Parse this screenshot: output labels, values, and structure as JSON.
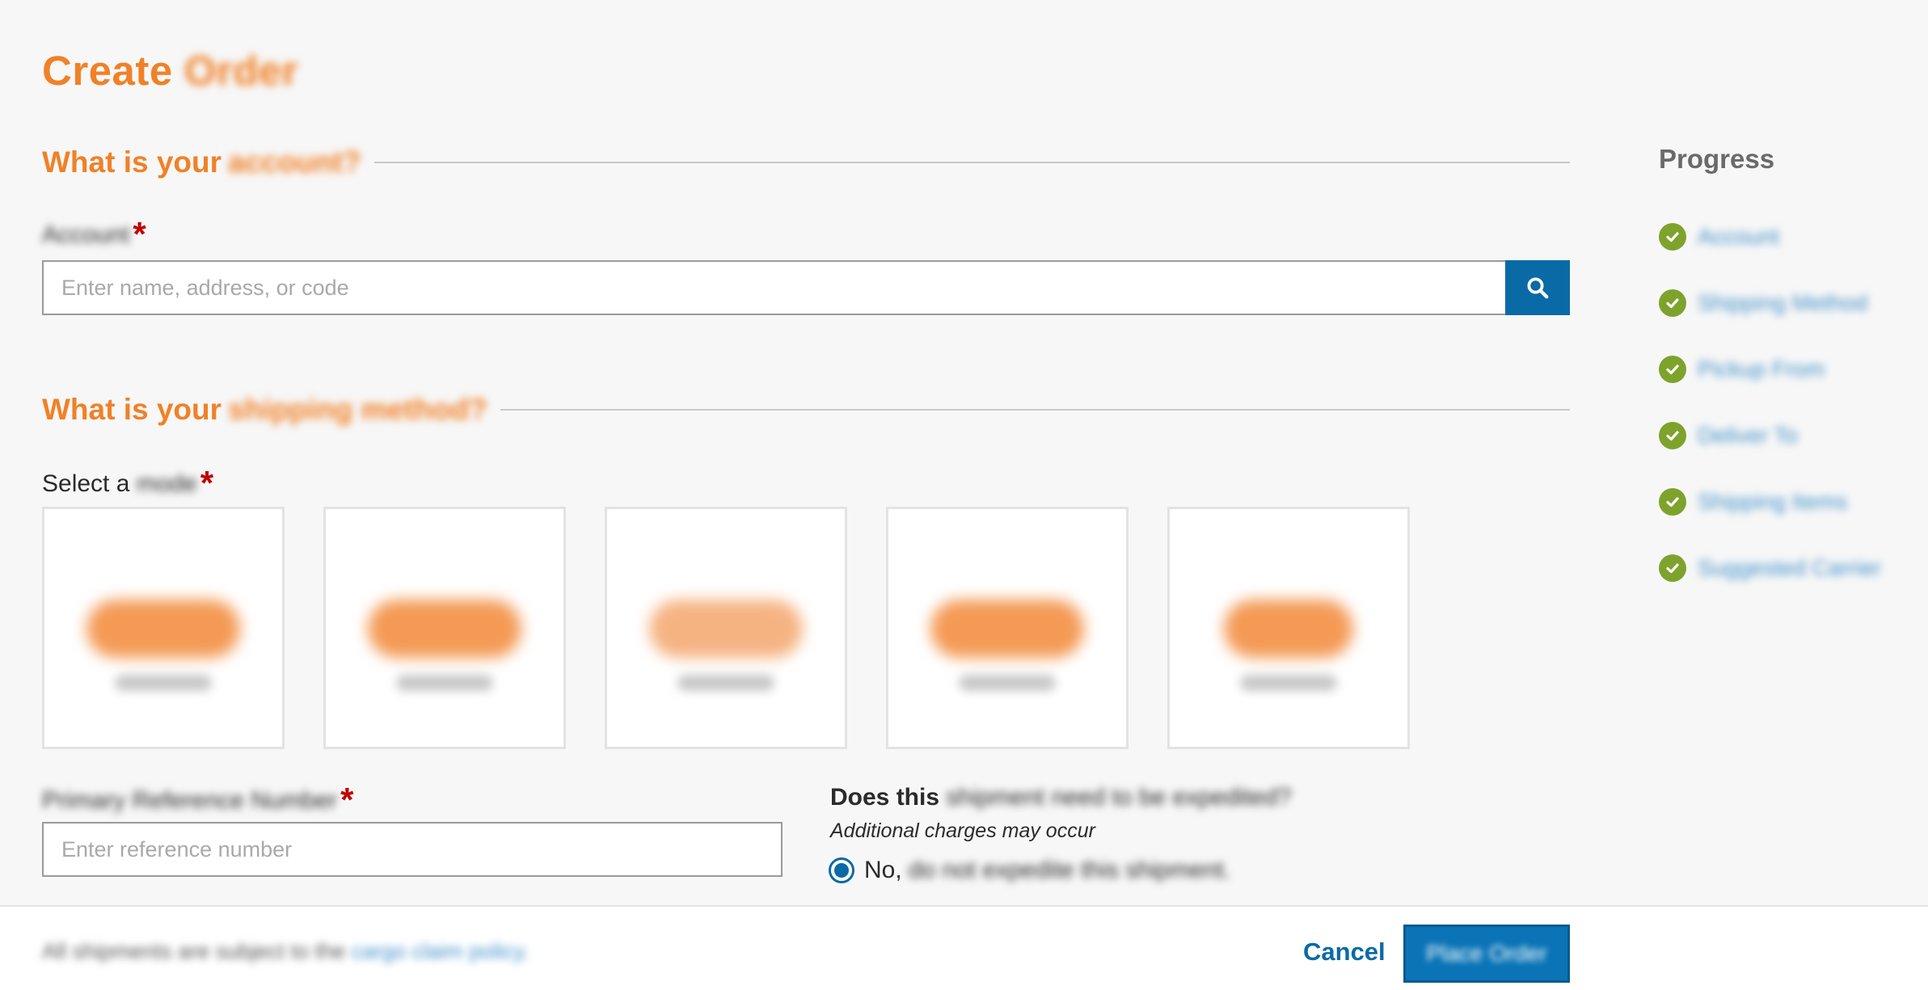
{
  "page": {
    "title": "Create",
    "title_blurred": "Order"
  },
  "account_section": {
    "heading": "What is your",
    "heading_blurred": "account?",
    "label_blurred": "Account",
    "required_mark": "*",
    "placeholder": "Enter name, address, or code"
  },
  "shipping_section": {
    "heading": "What is your",
    "heading_blurred": "shipping method?",
    "mode_label": "Select a",
    "mode_label_blurred": "mode",
    "required_mark": "*",
    "mode_tiles": [
      {
        "name": "mode-tile-1"
      },
      {
        "name": "mode-tile-2"
      },
      {
        "name": "mode-tile-3"
      },
      {
        "name": "mode-tile-4"
      },
      {
        "name": "mode-tile-5"
      }
    ]
  },
  "reference": {
    "label_blurred": "Primary Reference Number",
    "required_mark": "*",
    "placeholder": "Enter reference number"
  },
  "expedite": {
    "question": "Does this",
    "question_blurred": "shipment need to be expedited?",
    "note": "Additional charges may occur",
    "option_prefix": "No,",
    "option_blurred": "do not expedite this shipment."
  },
  "progress": {
    "title": "Progress",
    "items": [
      {
        "label": "Account"
      },
      {
        "label": "Shipping Method"
      },
      {
        "label": "Pickup From"
      },
      {
        "label": "Deliver To"
      },
      {
        "label": "Shipping Items"
      },
      {
        "label": "Suggested Carrier"
      }
    ]
  },
  "footer": {
    "note": "All shipments are subject to the",
    "note_link": "cargo claim policy.",
    "cancel_label": "Cancel",
    "place_order_label": "Place Order"
  },
  "colors": {
    "accent_orange": "#f08127",
    "primary_blue": "#0a6aa6",
    "check_green": "#7ea32c",
    "required_red": "#c00000"
  }
}
